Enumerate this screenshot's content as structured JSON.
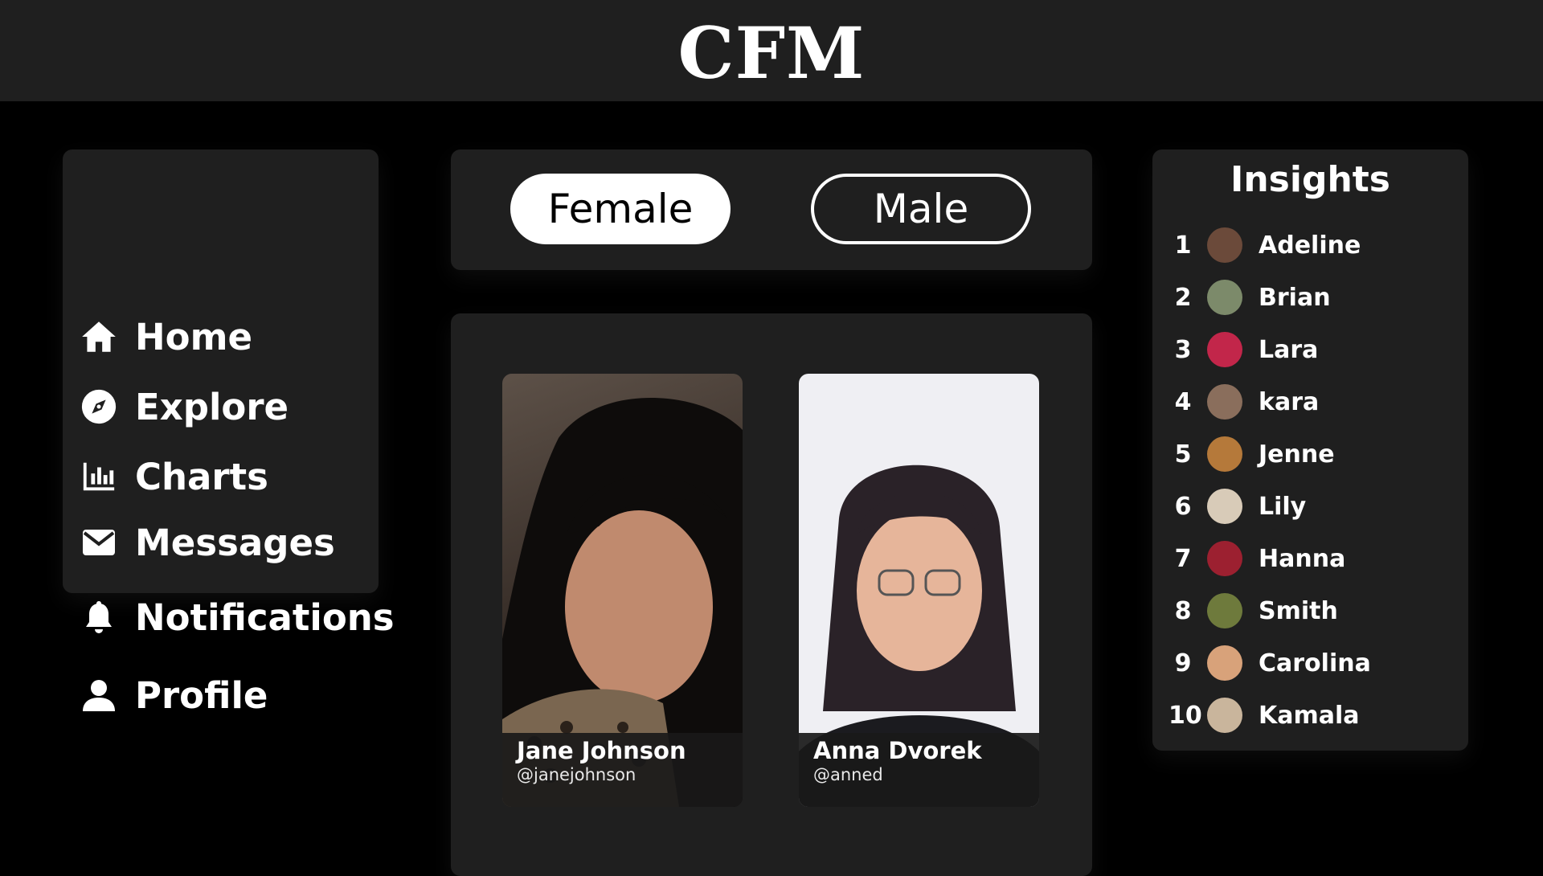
{
  "app": {
    "brand": "CFM"
  },
  "nav": {
    "items": [
      {
        "label": "Home",
        "icon": "home-icon"
      },
      {
        "label": "Explore",
        "icon": "compass-icon"
      },
      {
        "label": "Charts",
        "icon": "bar-chart-icon"
      },
      {
        "label": "Messages",
        "icon": "envelope-icon"
      },
      {
        "label": "Notifications",
        "icon": "bell-icon"
      },
      {
        "label": "Profile",
        "icon": "user-icon"
      }
    ]
  },
  "filter": {
    "female_label": "Female",
    "male_label": "Male",
    "selected": "Female"
  },
  "cards": [
    {
      "name": "Jane Johnson",
      "handle": "@janejohnson"
    },
    {
      "name": "Anna Dvorek",
      "handle": "@anned"
    }
  ],
  "insights": {
    "title": "Insights",
    "ranking": [
      {
        "rank": "1",
        "name": "Adeline",
        "avatar_color": "#6b4a3a"
      },
      {
        "rank": "2",
        "name": "Brian",
        "avatar_color": "#7c8a6a"
      },
      {
        "rank": "3",
        "name": "Lara",
        "avatar_color": "#c2264a"
      },
      {
        "rank": "4",
        "name": "kara",
        "avatar_color": "#8a6e5c"
      },
      {
        "rank": "5",
        "name": "Jenne",
        "avatar_color": "#b5793a"
      },
      {
        "rank": "6",
        "name": "Lily",
        "avatar_color": "#d8cbb8"
      },
      {
        "rank": "7",
        "name": "Hanna",
        "avatar_color": "#9c2030"
      },
      {
        "rank": "8",
        "name": "Smith",
        "avatar_color": "#6e7a3c"
      },
      {
        "rank": "9",
        "name": "Carolina",
        "avatar_color": "#d8a27a"
      },
      {
        "rank": "10",
        "name": "Kamala",
        "avatar_color": "#c9b59c"
      }
    ]
  }
}
